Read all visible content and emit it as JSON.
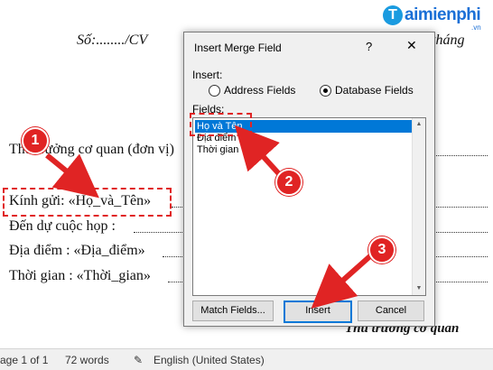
{
  "logo": {
    "text": "aimienphi",
    "sub": ".vn",
    "mark": "T"
  },
  "document": {
    "so_cv": "Số:......../CV",
    "thang": "tháng",
    "thu_truong": "Thủ trưởng cơ quan (đơn vị)",
    "kinh_gui": "Kính gửi: «Họ_và_Tên»",
    "den_du": "Đến dự cuộc họp :",
    "dia_diem": "Địa điểm : «Địa_điểm»",
    "thoi_gian": "Thời gian : «Thời_gian»",
    "signature": "Thủ trưởng cơ quan"
  },
  "dialog": {
    "title": "Insert Merge Field",
    "help": "?",
    "close": "✕",
    "insert_label": "Insert:",
    "radio_address": "Address Fields",
    "radio_database": "Database Fields",
    "selected_radio": "Database Fields",
    "fields_label": "Fields:",
    "fields": [
      "Họ và Tên",
      "Địa điểm",
      "Thời gian"
    ],
    "selected_field": "Họ và Tên",
    "match_fields_button": "Match Fields...",
    "insert_button": "Insert",
    "cancel_button": "Cancel"
  },
  "status_bar": {
    "page": "age 1 of 1",
    "words": "72 words",
    "language": "English (United States)"
  },
  "annotations": {
    "badge1": "1",
    "badge2": "2",
    "badge3": "3",
    "color": "#e02424"
  }
}
